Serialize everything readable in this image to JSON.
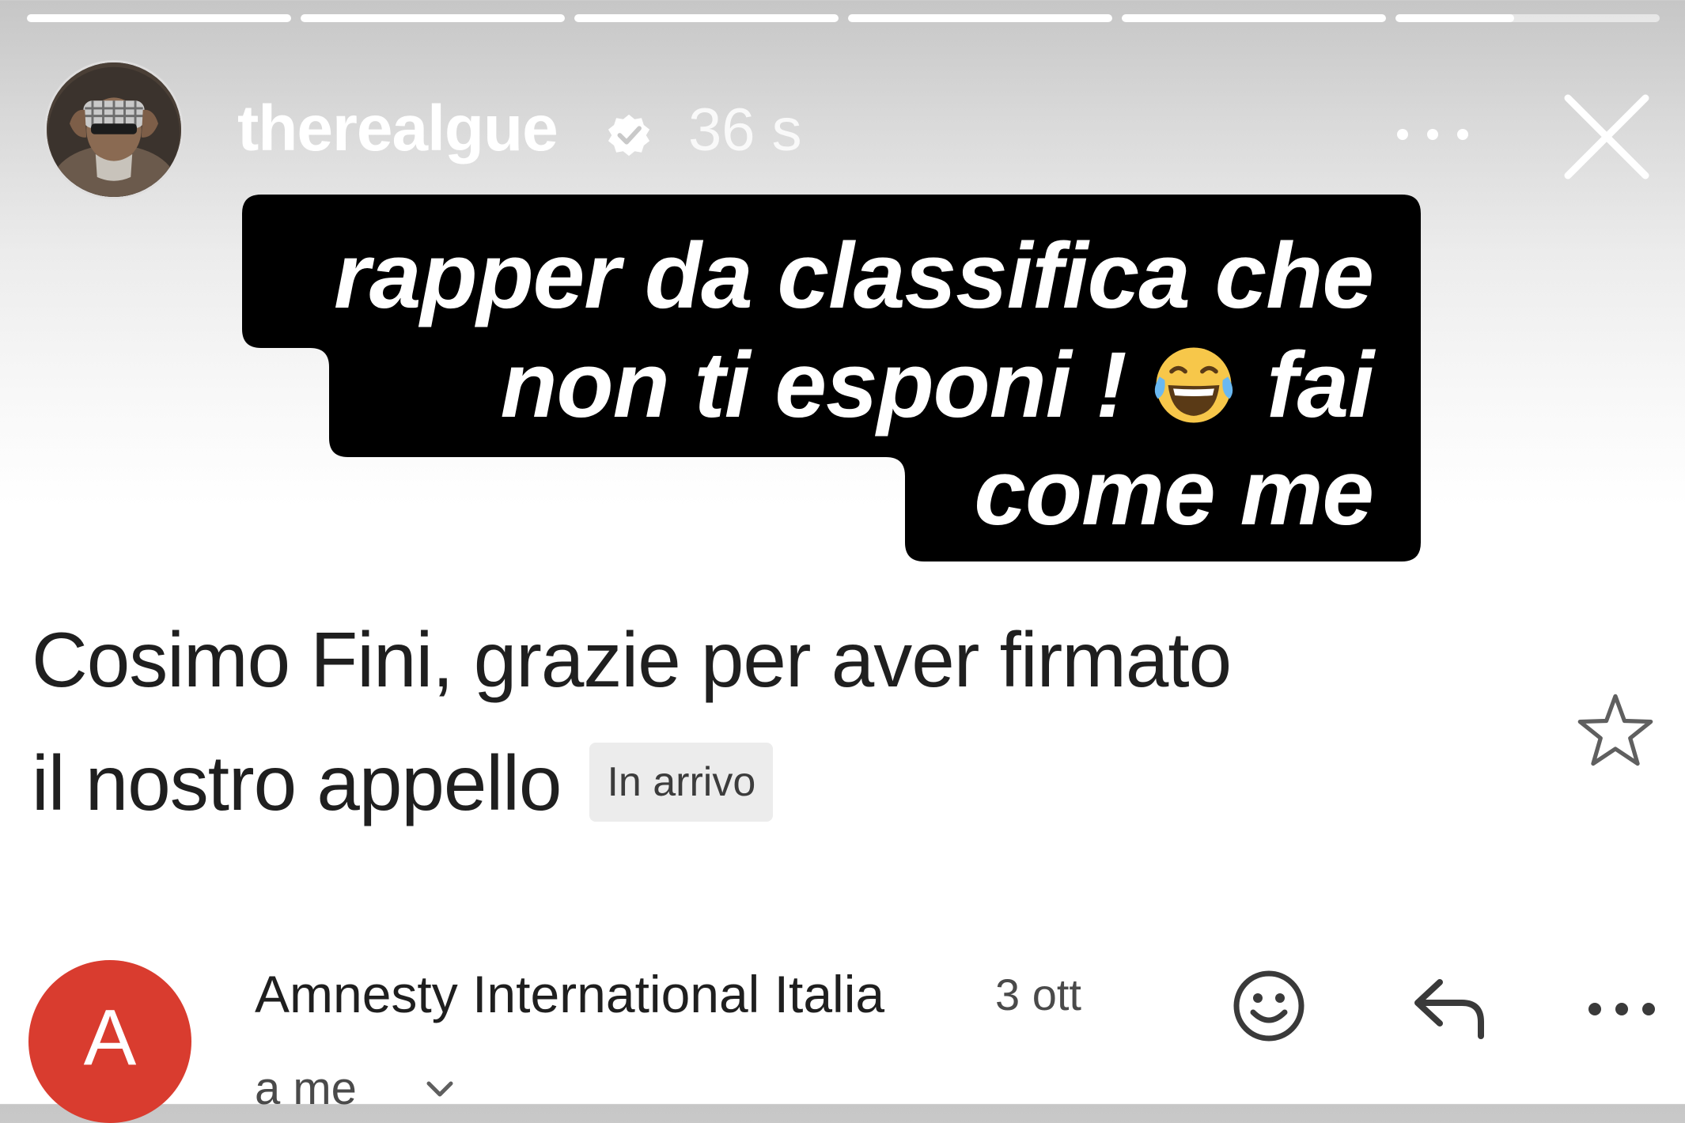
{
  "story": {
    "progress": [
      1,
      1,
      1,
      1,
      1,
      0.45
    ],
    "username": "therealgue",
    "verified": true,
    "time": "36 s",
    "more_icon": "more-horizontal-icon",
    "close_icon": "close-icon",
    "sticker": {
      "lines": [
        "rapper da classifica che",
        "non ti esponi !",
        "fai",
        "come me"
      ],
      "emoji": "face-with-tears-of-joy",
      "background": "#000000",
      "text_color": "#ffffff"
    }
  },
  "email": {
    "subject_line1": "Cosimo Fini, grazie per aver firmato",
    "subject_line2": "il nostro appello",
    "label": "In arrivo",
    "star_icon": "star-outline-icon",
    "sender": {
      "initial": "A",
      "name": "Amnesty International Italia",
      "date": "3 ott",
      "recipient": "a me",
      "avatar_color": "#d93c2f"
    },
    "actions": {
      "react_icon": "smiley-icon",
      "reply_icon": "reply-icon",
      "more_icon": "more-horizontal-icon"
    }
  }
}
